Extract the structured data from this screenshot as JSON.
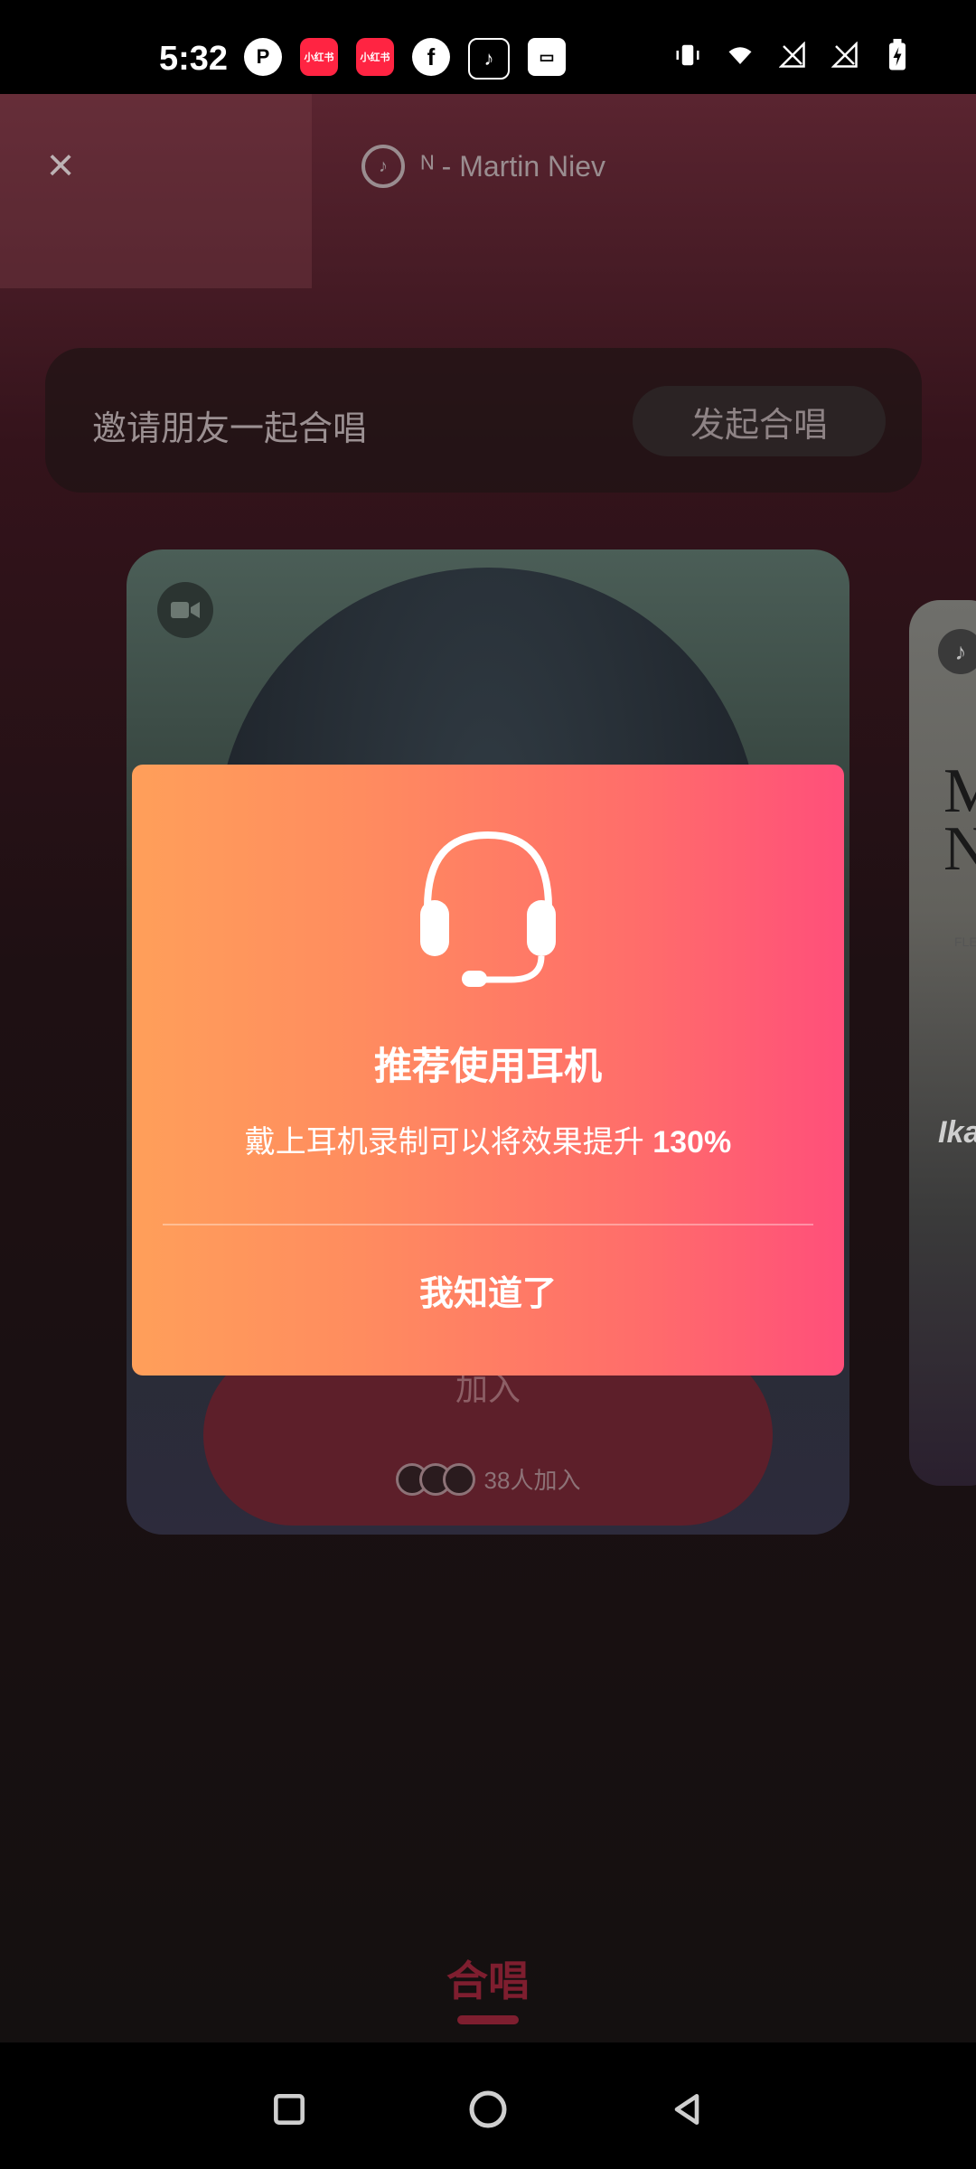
{
  "status_bar": {
    "time": "5:32",
    "apps": [
      {
        "name": "plex-icon",
        "glyph": "P"
      },
      {
        "name": "xiaohongshu-icon",
        "glyph": "小红书"
      },
      {
        "name": "xiaohongshu-icon-2",
        "glyph": "小红书"
      },
      {
        "name": "facebook-icon",
        "glyph": "f"
      },
      {
        "name": "tiktok-icon",
        "glyph": "♪"
      },
      {
        "name": "box-icon",
        "glyph": "▭"
      }
    ]
  },
  "header": {
    "close_icon": "×",
    "song_title": "ᴺ - Martin Niev",
    "music_icon": "♪"
  },
  "invite": {
    "text": "邀请朋友一起合唱",
    "start_button": "发起合唱"
  },
  "card": {
    "join_label": "加入",
    "join_count": "38人加入"
  },
  "side_card": {
    "big_text": "M\nN",
    "small_text": "FLE",
    "label": "Ika"
  },
  "dialog": {
    "title": "推荐使用耳机",
    "description": "戴上耳机录制可以将效果提升",
    "description_highlight": "130%",
    "ack_button": "我知道了"
  },
  "bottom_tab": {
    "label": "合唱"
  },
  "colors": {
    "accent": "#ff4f7a",
    "dialog_start": "#ff9f5a",
    "dialog_end": "#ff4f7a",
    "tab_accent": "#7e1e2f"
  }
}
